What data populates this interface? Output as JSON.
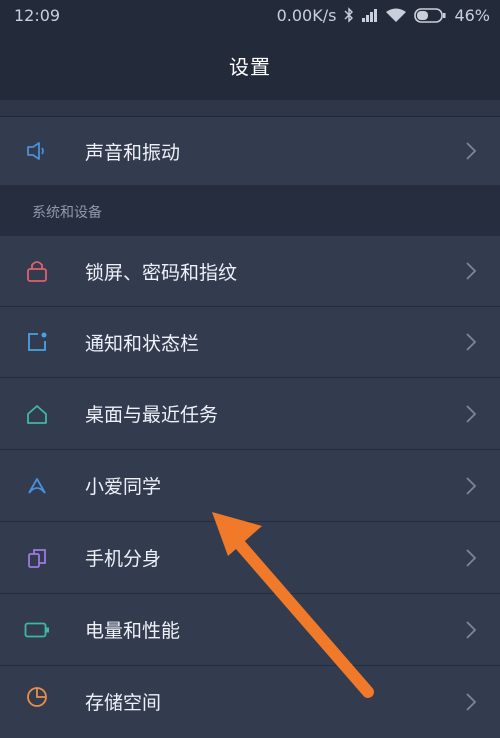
{
  "status_bar": {
    "time": "12:09",
    "network_speed": "0.00K/s",
    "battery": "46%",
    "icons": [
      "bluetooth-icon",
      "signal-icon",
      "wifi-icon",
      "battery-icon"
    ]
  },
  "header": {
    "title": "设置"
  },
  "rows_top": [
    {
      "label": "声音和振动",
      "icon": "speaker-icon",
      "color": "#4a90d9"
    }
  ],
  "section": {
    "title": "系统和设备"
  },
  "rows": [
    {
      "label": "锁屏、密码和指纹",
      "icon": "lock-icon",
      "color": "#e0606f"
    },
    {
      "label": "通知和状态栏",
      "icon": "notification-icon",
      "color": "#4aa3e0"
    },
    {
      "label": "桌面与最近任务",
      "icon": "home-icon",
      "color": "#3fb8a0"
    },
    {
      "label": "小爱同学",
      "icon": "xiaoai-icon",
      "color": "#4a8fe0"
    },
    {
      "label": "手机分身",
      "icon": "clone-icon",
      "color": "#9b7be0"
    },
    {
      "label": "电量和性能",
      "icon": "battery-perf-icon",
      "color": "#3fb8a0"
    },
    {
      "label": "存储空间",
      "icon": "storage-icon",
      "color": "#e8904a"
    }
  ],
  "colors": {
    "background": "#2a3142",
    "row": "#333b4f",
    "annotation_arrow": "#f07a2a"
  }
}
